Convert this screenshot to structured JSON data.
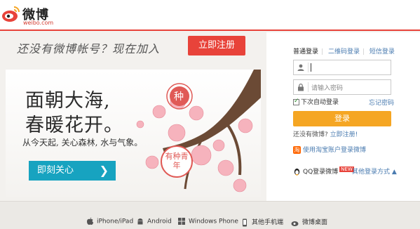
{
  "header": {
    "logo_text": "微博",
    "logo_sub": "weibo.com"
  },
  "signup": {
    "prompt": "还没有微博帐号？现在加入",
    "button": "立即注册"
  },
  "banner": {
    "line1": "面朝大海,",
    "line2": "春暖花开。",
    "sub": "从今天起, 关心森林, 水与气象。",
    "follow_button": "即刻关心",
    "seal1": "种",
    "seal2": "有种青年"
  },
  "login": {
    "tabs": [
      "普通登录",
      "二维码登录",
      "短信登录"
    ],
    "password_placeholder": "请输入密码",
    "remember_label": "下次自动登录",
    "forgot_label": "忘记密码",
    "login_button": "登录",
    "no_account_text": "还没有微博?",
    "register_link": "立即注册!",
    "taobao_label": "使用淘宝账户登录微博",
    "qq_label": "QQ登录微博",
    "qq_badge": "NEW",
    "other_label": "其他登录方式 ▲"
  },
  "footer": {
    "items": [
      "iPhone/iPad",
      "Android",
      "Windows Phone",
      "其他手机端",
      "微博桌面"
    ]
  },
  "colors": {
    "brand_red": "#e8433a",
    "login_orange": "#f5a623",
    "follow_teal": "#17a3c0",
    "link_blue": "#4a7bb0"
  }
}
